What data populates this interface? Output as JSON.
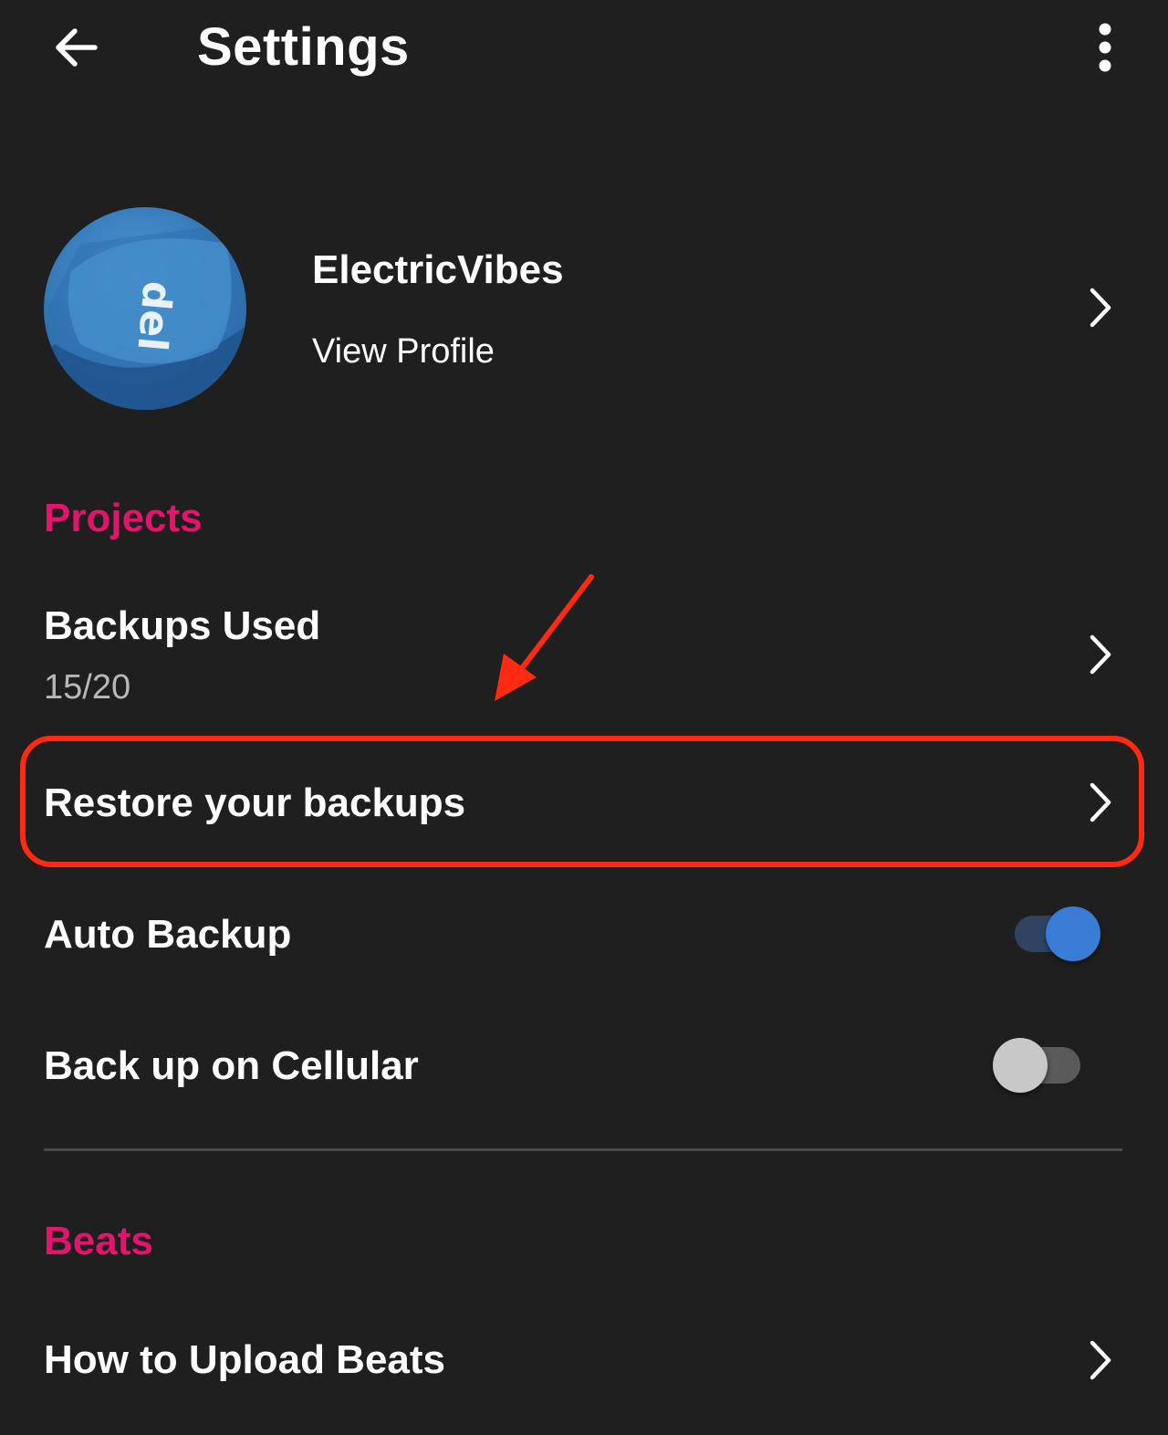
{
  "header": {
    "title": "Settings",
    "back_icon": "arrow-left-icon",
    "more_icon": "more-vertical-icon"
  },
  "profile": {
    "name": "ElectricVibes",
    "link_label": "View Profile",
    "avatar_text": "del"
  },
  "sections": {
    "projects": {
      "title": "Projects",
      "backups_used": {
        "label": "Backups Used",
        "value": "15/20"
      },
      "restore": {
        "label": "Restore your backups"
      },
      "auto_backup": {
        "label": "Auto Backup",
        "enabled": true
      },
      "cellular": {
        "label": "Back up on Cellular",
        "enabled": false
      }
    },
    "beats": {
      "title": "Beats",
      "upload": {
        "label": "How to Upload Beats"
      }
    }
  },
  "colors": {
    "background": "#1f1f20",
    "accent_section": "#e0156b",
    "toggle_on": "#3a7bd5",
    "annotation": "#ff2a12"
  }
}
